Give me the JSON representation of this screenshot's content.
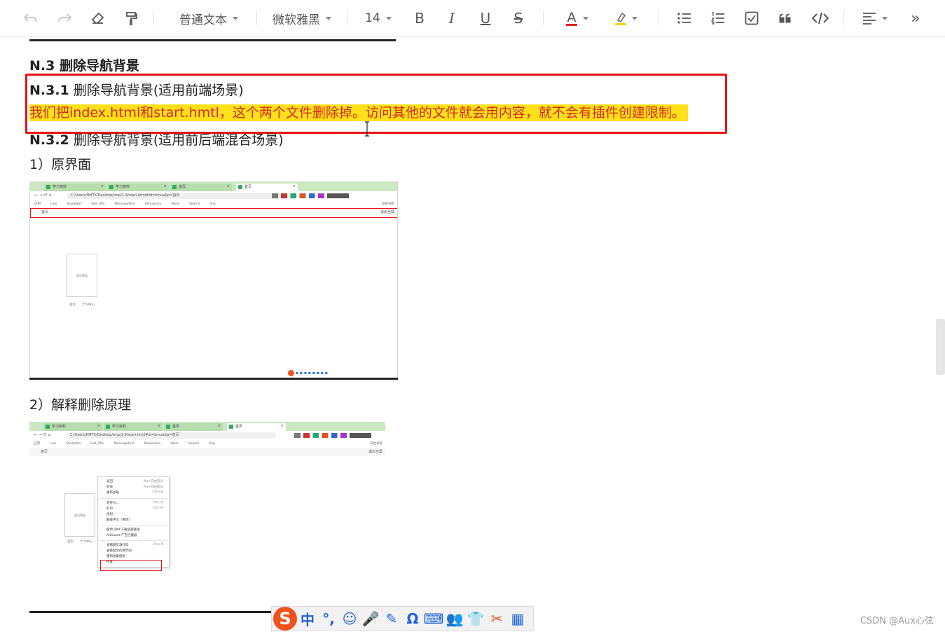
{
  "toolbar": {
    "paragraph_style": "普通文本",
    "font_family": "微软雅黑",
    "font_size": "14",
    "bold": "B",
    "italic": "I",
    "underline": "U",
    "strike": "S",
    "font_color": "A",
    "more": "»"
  },
  "doc": {
    "h3": "N.3 删除导航背景",
    "h4_1_num": "N.3.1",
    "h4_1_text": " 删除导航背景(适用前端场景)",
    "highlight": "我们把index.html和start.hmtl，这个两个文件删除掉。访问其他的文件就会用内容，就不会有插件创建限制。",
    "h4_2_num": "N.3.2",
    "h4_2_text": " 删除导航背景(适用前后端混合场景)",
    "item1": "1）原界面",
    "item2": "2）解释删除原理",
    "highlight_bg": "#ffe01a",
    "highlight_fg": "#d32a1e",
    "box_color": "#e81313"
  },
  "shot1": {
    "tabs": [
      "学习资料",
      "学习资料",
      "首页",
      "首页"
    ],
    "url": "C:/Users/HMTX/Desktop/tmp/1-9/start.html#id=kmua&p=首页",
    "bookmarks": [
      "应用",
      "Live",
      "StudyNot",
      "Self_URL",
      "MessageFind",
      "Relaxation",
      "Work",
      "Search",
      "Imp"
    ],
    "nav_item": "首页",
    "nav_right": "退出全屏",
    "thumb": "首页界面",
    "thumb_labels": [
      "首页",
      "个人中心"
    ],
    "bm_right": "其他书签"
  },
  "shot2": {
    "tabs": [
      "学习资料",
      "学习资料",
      "首页",
      "首页"
    ],
    "url": "C:/Users/HMTX/Desktop/tmp/1-9/start.html#id=kmua&p=首页",
    "nav_item": "首页",
    "nav_right": "退出全屏",
    "thumb": "首页界面",
    "thumb_labels": [
      "首页",
      "个人中心"
    ],
    "menu": [
      {
        "label": "返回",
        "key": "Alt+向左箭头"
      },
      {
        "label": "前进",
        "key": "Alt+向右箭头"
      },
      {
        "label": "重新加载",
        "key": "Ctrl+R"
      },
      {
        "label": "另存为...",
        "key": "Ctrl+S"
      },
      {
        "label": "打印...",
        "key": "Ctrl+P"
      },
      {
        "label": "投射...",
        "key": ""
      },
      {
        "label": "翻成中文（简体）",
        "key": ""
      },
      {
        "label": "使用 IDM 下载全部链接",
        "key": ""
      },
      {
        "label": "AdGuard 广告拦截器",
        "key": ""
      },
      {
        "label": "查看网页源代码",
        "key": "Ctrl+U"
      },
      {
        "label": "查看框架的源代码",
        "key": ""
      },
      {
        "label": "重新加载框架",
        "key": ""
      },
      {
        "label": "检查",
        "key": ""
      }
    ]
  },
  "ime": {
    "logo": "S",
    "items": [
      "中",
      "°,",
      "☺",
      "🎤",
      "✎",
      "Ω",
      "⌨",
      "👥",
      "👕",
      "✂",
      "▦"
    ]
  },
  "watermark": "CSDN @Aux心弦"
}
